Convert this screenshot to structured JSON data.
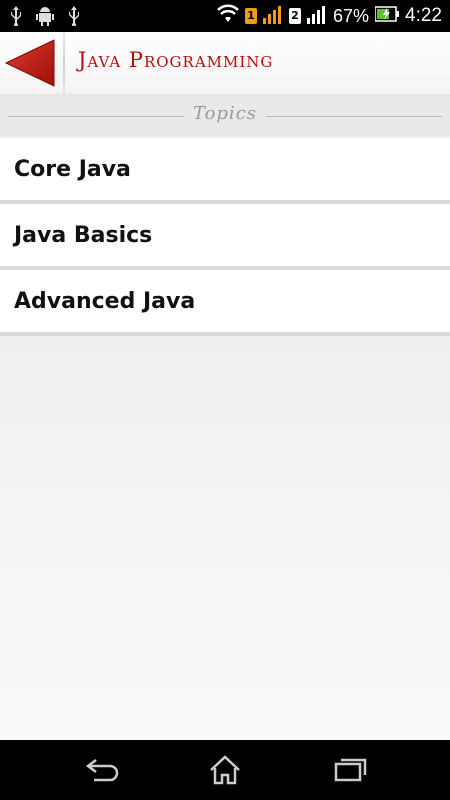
{
  "status_bar": {
    "left_icons": [
      "usb-icon",
      "android-debug-icon",
      "usb-icon"
    ],
    "sim1_badge": "1",
    "sim2_badge": "2",
    "battery": "67%",
    "time": "4:22"
  },
  "action_bar": {
    "title": "Java Programming",
    "back_icon": "back-arrow-icon",
    "accent_color": "#b30f0f"
  },
  "section": {
    "title": "Topics"
  },
  "topics": [
    {
      "label": "Core Java"
    },
    {
      "label": "Java Basics"
    },
    {
      "label": "Advanced Java"
    }
  ],
  "nav_bar": {
    "icons": [
      "back-icon",
      "home-icon",
      "recent-apps-icon"
    ]
  }
}
